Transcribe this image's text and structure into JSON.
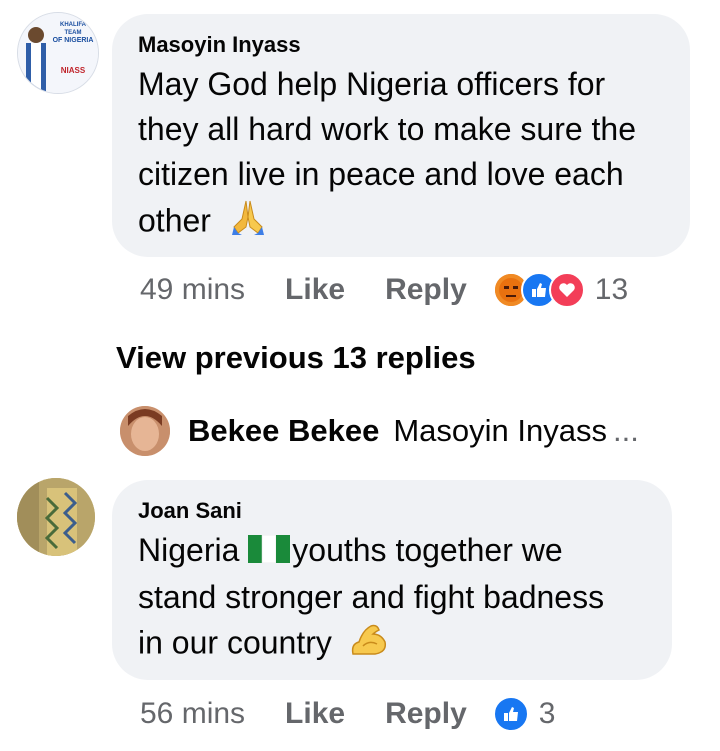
{
  "comments": [
    {
      "author": "Masoyin Inyass",
      "avatar_text": [
        "KHALIFA TEAM",
        "OF NIGERIA",
        "NIASS"
      ],
      "text_lines": [
        "May God help Nigeria officers for",
        "they all hard work to make sure the",
        "citizen live in peace and love each",
        "other"
      ],
      "emoji": "folded-hands-emoji",
      "time": "49 mins",
      "like_label": "Like",
      "reply_label": "Reply",
      "reactions": [
        "angry-reaction",
        "like-reaction",
        "love-reaction"
      ],
      "reaction_count": "13"
    },
    {
      "author": "Joan Sani",
      "text_before_flag": "Nigeria ",
      "flag": "nigeria-flag-emoji",
      "text_after_flag": "youths together we",
      "text_lines": [
        "stand  stronger and fight badness",
        "in our country"
      ],
      "emoji": "flexed-biceps-emoji",
      "time": "56 mins",
      "like_label": "Like",
      "reply_label": "Reply",
      "reactions": [
        "like-reaction"
      ],
      "reaction_count": "3"
    }
  ],
  "view_previous": "View previous 13 replies",
  "inline_reply": {
    "author": "Bekee Bekee",
    "preview": "Masoyin Inyass",
    "ellipsis": "..."
  },
  "colors": {
    "bubble": "#f0f2f5",
    "meta": "#65676b",
    "like_blue": "#1877f2",
    "love_red": "#f33e58",
    "angry_orange": "#e9710f"
  }
}
